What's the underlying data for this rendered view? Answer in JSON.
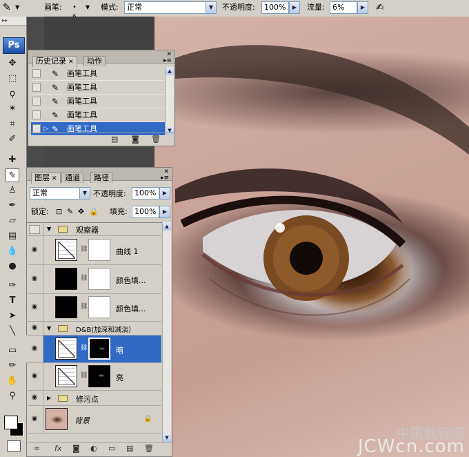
{
  "options_bar": {
    "brush_label": "画笔:",
    "brush_size": "6",
    "mode_label": "模式:",
    "mode_value": "正常",
    "opacity_label": "不透明度:",
    "opacity_value": "100%",
    "flow_label": "流量:",
    "flow_value": "6%"
  },
  "toolbox": {
    "logo": "Ps"
  },
  "history_panel": {
    "tabs": [
      {
        "label": "历史记录"
      },
      {
        "label": "动作"
      }
    ],
    "rows": [
      {
        "label": "画笔工具"
      },
      {
        "label": "画笔工具"
      },
      {
        "label": "画笔工具"
      },
      {
        "label": "画笔工具"
      },
      {
        "label": "画笔工具",
        "selected": true
      }
    ]
  },
  "layers_panel": {
    "tabs": [
      {
        "label": "图层"
      },
      {
        "label": "通道"
      },
      {
        "label": "路径"
      }
    ],
    "blend_mode": "正常",
    "opacity_label": "不透明度:",
    "opacity_value": "100%",
    "lock_label": "锁定:",
    "fill_label": "填充:",
    "fill_value": "100%",
    "layers": [
      {
        "name": "观察器",
        "kind": "group",
        "visible": false,
        "expanded": true
      },
      {
        "name": "曲线 1",
        "kind": "curves",
        "visible": true
      },
      {
        "name": "颜色填...",
        "kind": "fill",
        "visible": true
      },
      {
        "name": "颜色填...",
        "kind": "fill",
        "visible": true
      },
      {
        "name": "D&B(加深和减淡）",
        "kind": "group",
        "visible": true,
        "expanded": true
      },
      {
        "name": "暗",
        "kind": "curves",
        "visible": true,
        "selected": true
      },
      {
        "name": "亮",
        "kind": "curves",
        "visible": true
      },
      {
        "name": "修污点",
        "kind": "group",
        "visible": true,
        "expanded": false
      },
      {
        "name": "背景",
        "kind": "background",
        "visible": true,
        "locked": true
      }
    ]
  },
  "watermark": {
    "cn_text": "中国教程网",
    "en_text": "JCWcn.com"
  },
  "colors": {
    "selection": "#316ac5",
    "panel_bg": "#d4d0c8"
  }
}
